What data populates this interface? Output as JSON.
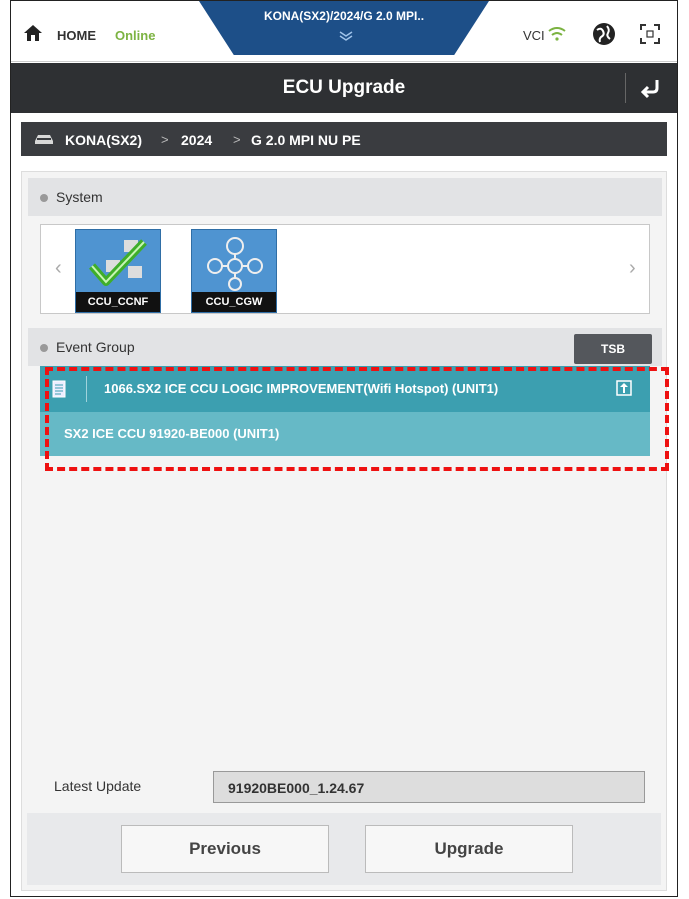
{
  "topbar": {
    "home_label": "HOME",
    "status": "Online",
    "vehicle_tab": "KONA(SX2)/2024/G 2.0 MPI..",
    "vci_label": "VCI",
    "icons": [
      "home-icon",
      "wifi-icon",
      "globe-icon",
      "expand-icon",
      "chevron-down-icon"
    ]
  },
  "header": {
    "title": "ECU Upgrade"
  },
  "breadcrumb": {
    "items": [
      "KONA(SX2)",
      "2024",
      "G 2.0 MPI NU PE"
    ],
    "separator": ">"
  },
  "system": {
    "label": "System",
    "tiles": [
      {
        "label": "CCU_CCNF",
        "icon": "checkmark-icon"
      },
      {
        "label": "CCU_CGW",
        "icon": "network-icon"
      }
    ]
  },
  "event_group": {
    "label": "Event Group",
    "tsb_label": "TSB",
    "event_title": "1066.SX2 ICE CCU LOGIC IMPROVEMENT(Wifi Hotspot) (UNIT1)",
    "event_sub": "SX2 ICE CCU 91920-BE000 (UNIT1)"
  },
  "latest_update": {
    "label": "Latest Update",
    "value": "91920BE000_1.24.67"
  },
  "buttons": {
    "previous": "Previous",
    "upgrade": "Upgrade"
  },
  "colors": {
    "title_bar": "#2e3033",
    "vehicle_tab": "#1d4f88",
    "event_primary": "#3c9fb0",
    "event_secondary": "#66b9c6",
    "online": "#7cb342",
    "highlight": "#ee1111"
  }
}
